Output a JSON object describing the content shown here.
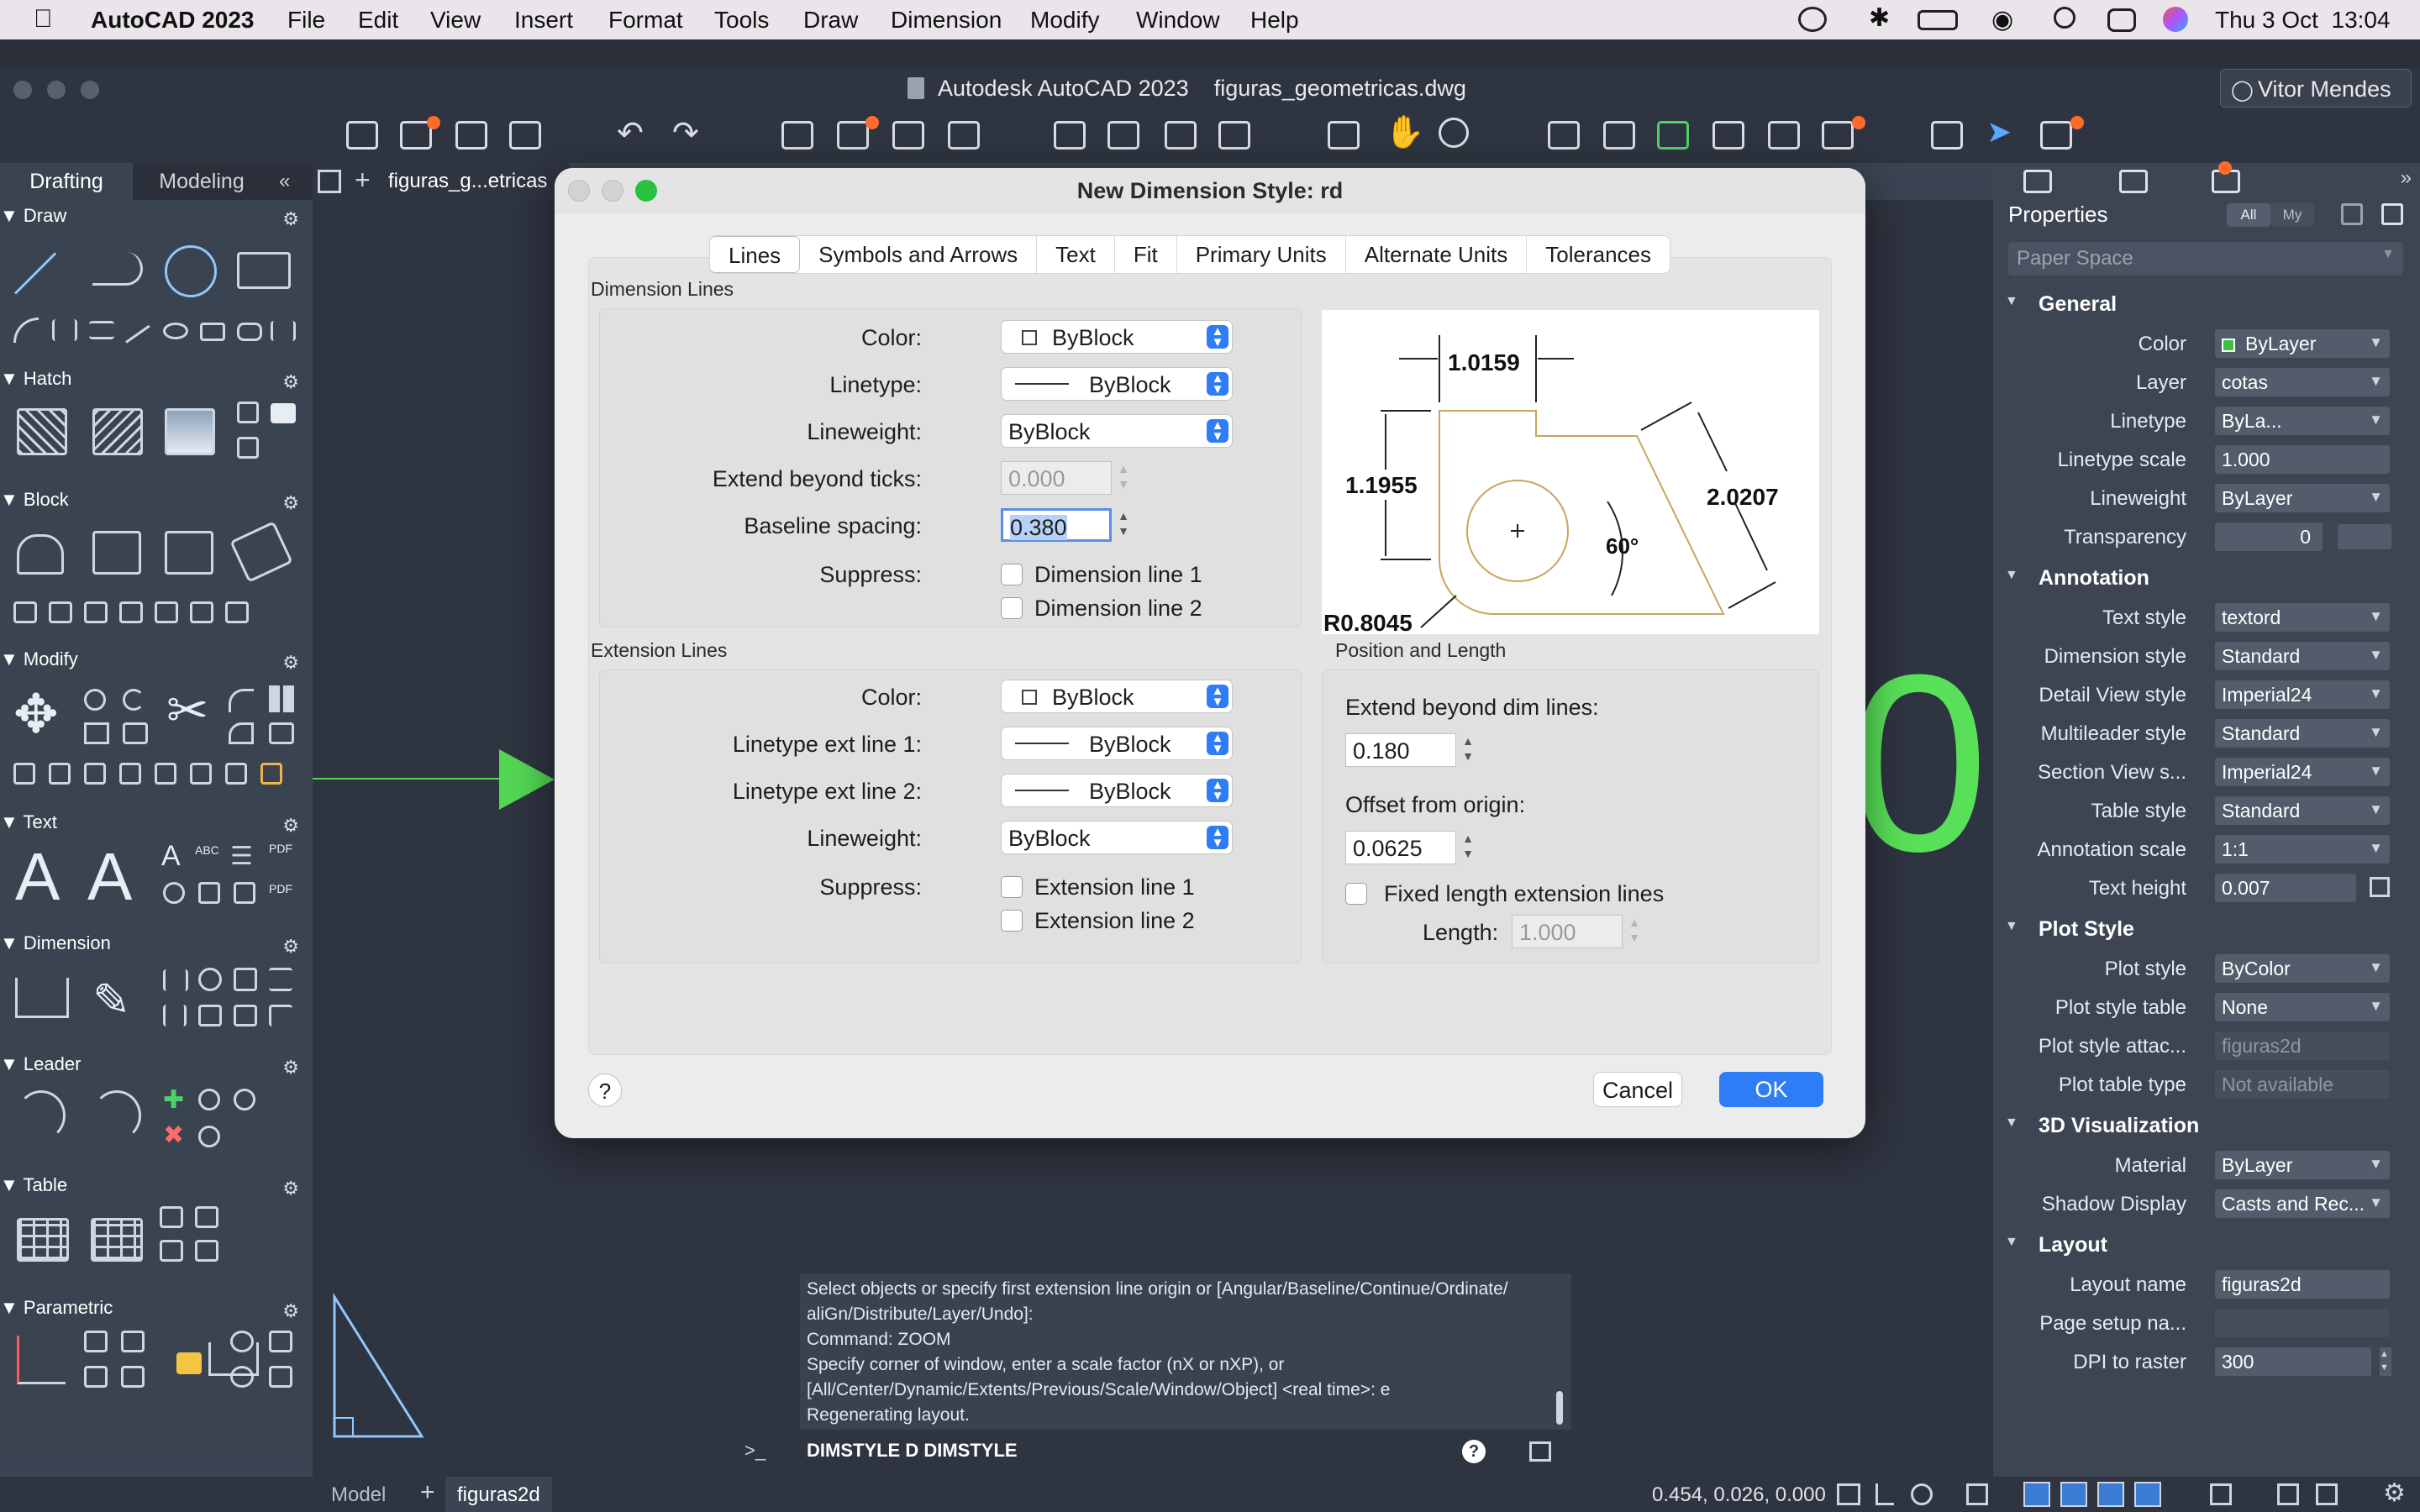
{
  "menubar": {
    "app": "AutoCAD 2023",
    "items": [
      "File",
      "Edit",
      "View",
      "Insert",
      "Format",
      "Tools",
      "Draw",
      "Dimension",
      "Modify",
      "Window",
      "Help"
    ],
    "clock": "Thu 3 Oct  13:04"
  },
  "window": {
    "title": "Autodesk AutoCAD 2023    figuras_geometricas.dwg",
    "user": "Vitor Mendes"
  },
  "workspace_tabs": [
    "Drafting",
    "Modeling"
  ],
  "doc_tab": "figuras_g...etricas",
  "palette": {
    "sections": [
      "Draw",
      "Hatch",
      "Block",
      "Modify",
      "Text",
      "Dimension",
      "Leader",
      "Table",
      "Parametric"
    ]
  },
  "dialog": {
    "title": "New Dimension Style: rd",
    "tabs": [
      "Lines",
      "Symbols and Arrows",
      "Text",
      "Fit",
      "Primary Units",
      "Alternate Units",
      "Tolerances"
    ],
    "dim_lines": {
      "group": "Dimension Lines",
      "color_label": "Color:",
      "color": "ByBlock",
      "linetype_label": "Linetype:",
      "linetype": "ByBlock",
      "lineweight_label": "Lineweight:",
      "lineweight": "ByBlock",
      "extend_label": "Extend beyond ticks:",
      "extend": "0.000",
      "baseline_label": "Baseline spacing:",
      "baseline": "0.380",
      "suppress_label": "Suppress:",
      "sup1": "Dimension line 1",
      "sup2": "Dimension line 2"
    },
    "ext_lines": {
      "group": "Extension Lines",
      "color_label": "Color:",
      "color": "ByBlock",
      "lt1_label": "Linetype ext line 1:",
      "lt1": "ByBlock",
      "lt2_label": "Linetype ext line 2:",
      "lt2": "ByBlock",
      "lineweight_label": "Lineweight:",
      "lineweight": "ByBlock",
      "suppress_label": "Suppress:",
      "sup1": "Extension line 1",
      "sup2": "Extension line 2"
    },
    "position": {
      "group": "Position and Length",
      "extend_label": "Extend beyond dim lines:",
      "extend": "0.180",
      "offset_label": "Offset from origin:",
      "offset": "0.0625",
      "fixed_label": "Fixed length extension lines",
      "length_label": "Length:",
      "length": "1.000"
    },
    "preview": {
      "d1": "1.0159",
      "d2": "1.1955",
      "d3": "2.0207",
      "angle": "60°",
      "radius": "R0.8045"
    },
    "help": "?",
    "cancel": "Cancel",
    "ok": "OK"
  },
  "properties": {
    "title": "Properties",
    "all": "All",
    "my": "My",
    "selector": "Paper Space",
    "groups": [
      {
        "name": "General",
        "rows": [
          [
            "Color",
            "ByLayer"
          ],
          [
            "Layer",
            "cotas"
          ],
          [
            "Linetype",
            "ByLa..."
          ],
          [
            "Linetype scale",
            "1.000"
          ],
          [
            "Lineweight",
            "ByLayer"
          ],
          [
            "Transparency",
            "0"
          ]
        ]
      },
      {
        "name": "Annotation",
        "rows": [
          [
            "Text style",
            "textord"
          ],
          [
            "Dimension style",
            "Standard"
          ],
          [
            "Detail View style",
            "Imperial24"
          ],
          [
            "Multileader style",
            "Standard"
          ],
          [
            "Section View s...",
            "Imperial24"
          ],
          [
            "Table style",
            "Standard"
          ],
          [
            "Annotation scale",
            "1:1"
          ],
          [
            "Text height",
            "0.007"
          ]
        ]
      },
      {
        "name": "Plot Style",
        "rows": [
          [
            "Plot style",
            "ByColor"
          ],
          [
            "Plot style table",
            "None"
          ],
          [
            "Plot style attac...",
            "figuras2d"
          ],
          [
            "Plot table type",
            "Not available"
          ]
        ]
      },
      {
        "name": "3D Visualization",
        "rows": [
          [
            "Material",
            "ByLayer"
          ],
          [
            "Shadow Display",
            "Casts and Rec..."
          ]
        ]
      },
      {
        "name": "Layout",
        "rows": [
          [
            "Layout name",
            "figuras2d"
          ],
          [
            "Page setup na...",
            ""
          ],
          [
            "DPI to raster",
            "300"
          ]
        ]
      }
    ]
  },
  "command": {
    "history": [
      "Select objects or specify first extension line origin or [Angular/Baseline/Continue/Ordinate/",
      "aliGn/Distribute/Layer/Undo]:",
      "Command: ZOOM",
      "Specify corner of window, enter a scale factor (nX or nXP), or",
      "[All/Center/Dynamic/Extents/Previous/Scale/Window/Object] <real time>: e",
      "Regenerating layout."
    ],
    "prompt": ">_",
    "input": "DIMSTYLE D DIMSTYLE"
  },
  "status": {
    "model": "Model",
    "layout": "figuras2d",
    "coords": "0.454, 0.026, 0.000"
  },
  "canvas": {
    "big_char": "0"
  }
}
